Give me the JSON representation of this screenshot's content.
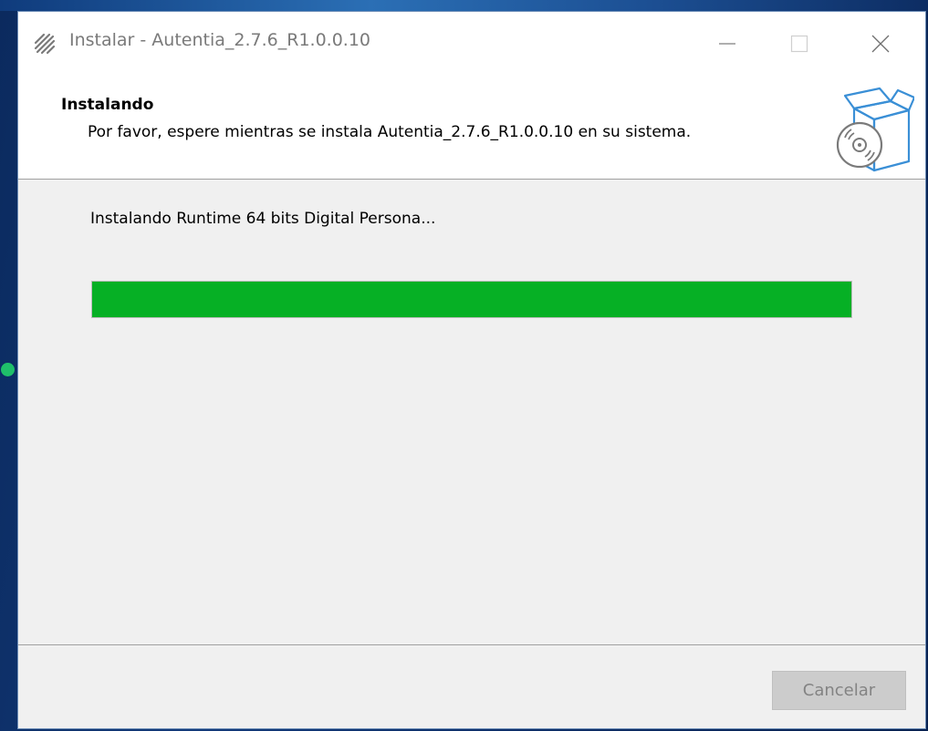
{
  "window": {
    "title": "Instalar - Autentia_2.7.6_R1.0.0.10"
  },
  "header": {
    "title": "Instalando",
    "subtitle": "Por favor, espere mientras se instala Autentia_2.7.6_R1.0.0.10 en su sistema."
  },
  "main": {
    "status": "Instalando Runtime 64 bits Digital Persona...",
    "progress_percent": 100,
    "progress_color": "#06b025"
  },
  "footer": {
    "cancel_label": "Cancelar"
  },
  "icons": {
    "app": "installer-app-icon",
    "header": "software-box-icon"
  }
}
